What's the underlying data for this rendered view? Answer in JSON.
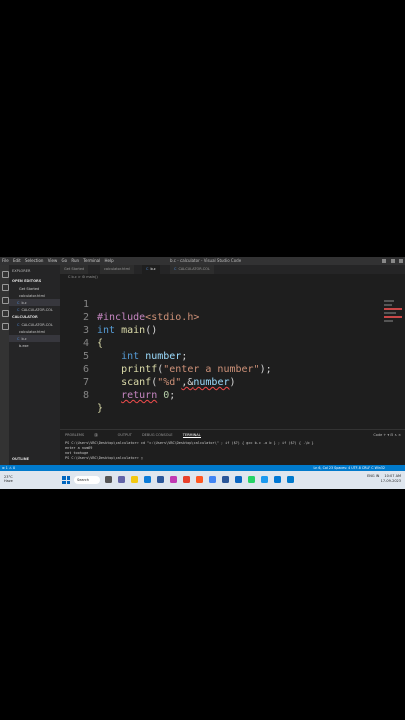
{
  "titlebar": {
    "menu": [
      "File",
      "Edit",
      "Selection",
      "View",
      "Go",
      "Run",
      "Terminal",
      "Help"
    ],
    "title": "b.c - calculator - Visual Studio Code"
  },
  "sidebar": {
    "header": "EXPLORER",
    "open_editors_title": "OPEN EDITORS",
    "open_editors": [
      {
        "icon": "",
        "label": "Get Started"
      },
      {
        "icon": "",
        "label": "calculator.html"
      },
      {
        "icon": "C",
        "label": "b.c"
      },
      {
        "icon": "C",
        "label": "CALCULATOR.COL"
      }
    ],
    "folder_title": "CALCULATOR",
    "folder_items": [
      {
        "icon": "C",
        "label": "CALCULATOR.COL"
      },
      {
        "icon": "",
        "label": "calculator.html"
      },
      {
        "icon": "C",
        "label": "b.c"
      },
      {
        "icon": "",
        "label": "b.exe"
      }
    ],
    "outline": "OUTLINE",
    "timeline": "TIMELINE"
  },
  "tabs": [
    {
      "icon": "",
      "label": "Get Started"
    },
    {
      "icon": "",
      "label": "calculator.html"
    },
    {
      "icon": "C",
      "label": "b.c"
    },
    {
      "icon": "C",
      "label": "CALCULATOR.COL"
    }
  ],
  "breadcrumb": "C  b.c > ⚙ main()",
  "code": {
    "line_numbers": [
      "1",
      "2",
      "3",
      "4",
      "5",
      "6",
      "7",
      "8"
    ],
    "l1_pre": "#include",
    "l1_hdr": "<stdio.h>",
    "l2_type": "int",
    "l2_fn": "main",
    "l2_rest": "()",
    "l3": "{",
    "l4_type": "int",
    "l4_var": "number",
    "l4_end": ";",
    "l5_fn": "printf",
    "l5_open": "(",
    "l5_str": "\"enter a number\"",
    "l5_end": ");",
    "l6_fn": "scanf",
    "l6_open": "(",
    "l6_str": "\"%d\"",
    "l6_mid": ",&",
    "l6_var": "number",
    "l6_end": ")",
    "l7_kw": "return",
    "l7_num": "0",
    "l7_end": ";",
    "l8": "}"
  },
  "panel": {
    "tabs": [
      "PROBLEMS",
      "OUTPUT",
      "DEBUG CONSOLE",
      "TERMINAL"
    ],
    "problems_count": "1",
    "controls": "Code  +  ▾  ⊟  ∧  ×",
    "terminal_lines": [
      "PS C:\\Users\\VBC\\Desktop\\calculator> cd \"c:\\Users\\VBC\\Desktop\\calculator\\\" ; if ($?) { gcc b.c -o b } ; if ($?) { .\\b }",
      "enter a num69",
      "not toohuge",
      "PS C:\\Users\\VBC\\Desktop\\calculator> ▯"
    ]
  },
  "statusbar": {
    "left": "⊗ 1 ⚠ 0",
    "right": "Ln 6, Col 23   Spaces: 4   UTF-8   CRLF   C   Win32"
  },
  "taskbar": {
    "weather_temp": "23°C",
    "weather_desc": "Haze",
    "search": "Search",
    "tray_lang": "ENG IN",
    "time": "10:07 AM",
    "date": "17-09-2023"
  },
  "colors": {
    "accent": "#007acc",
    "error": "#f14c4c"
  }
}
